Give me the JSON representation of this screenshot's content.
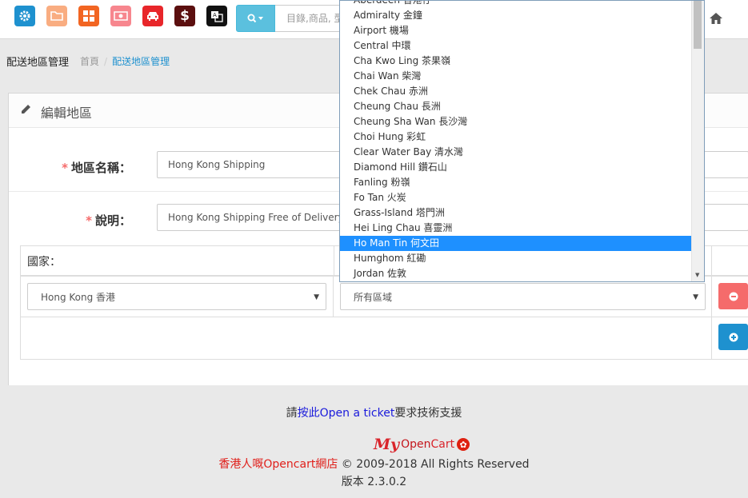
{
  "header": {
    "search_placeholder": "目錄,商品, 型",
    "icons": [
      "gear-icon",
      "folder-icon",
      "grid-icon",
      "banknote-icon",
      "car-icon",
      "dollar-icon",
      "translate-icon"
    ],
    "icon_colors": [
      "#1e91cf",
      "#f9ad81",
      "#f26522",
      "#f7868e",
      "#e8262a",
      "#5b0f0f",
      "#111111"
    ]
  },
  "breadcrumb": {
    "page_title": "配送地區管理",
    "home": "首頁",
    "separator": "/",
    "current": "配送地區管理"
  },
  "panel": {
    "title": "編輯地區",
    "name_label": "地區名稱：",
    "name_value": "Hong Kong Shipping",
    "desc_label": "說明：",
    "desc_value": "Hong Kong Shipping Free of Delivery",
    "required_mark": "*",
    "country_header": "國家：",
    "country_value": "Hong Kong 香港",
    "zone_value": "所有區域"
  },
  "zone_dropdown": {
    "selected_index": 16,
    "options": [
      "Aberdeen 香港仔",
      "Admiralty 金鐘",
      "Airport 機場",
      "Central 中環",
      "Cha Kwo Ling 茶果嶺",
      "Chai Wan 柴灣",
      "Chek Chau 赤洲",
      "Cheung Chau 長洲",
      "Cheung Sha Wan 長沙灣",
      "Choi Hung 彩虹",
      "Clear Water Bay 清水灣",
      "Diamond Hill 鑽石山",
      "Fanling 粉嶺",
      "Fo Tan 火炭",
      "Grass-Island 塔門洲",
      "Hei Ling Chau 喜靈洲",
      "Ho Man Tin 何文田",
      "Humghom 紅磡",
      "Jordan 佐敦"
    ]
  },
  "footer": {
    "support_prefix": "請",
    "support_link": "按此Open a ticket",
    "support_suffix": "要求技術支援",
    "logo_my": "My",
    "logo_open": "Open",
    "logo_cart": "Cart",
    "shop_name": "香港人嘅Opencart網店",
    "copyright": " © 2009-2018 All Rights Reserved",
    "version": "版本 2.3.0.2"
  },
  "colors": {
    "accent": "#1e91cf",
    "danger": "#f56b6b",
    "primary": "#1e91cf",
    "info": "#5bc0de",
    "selected_option": "#1e90ff"
  }
}
